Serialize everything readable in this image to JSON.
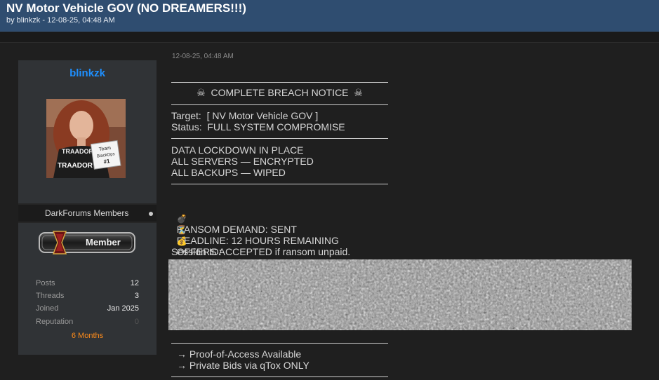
{
  "thread": {
    "title": "NV Motor Vehicle GOV (NO DREAMERS!!!)",
    "meta": "by blinkzk - 12-08-25, 04:48 AM"
  },
  "sidebar": {
    "username": "blinkzk",
    "avatar_label": "profile-photo",
    "sign_text": "Team BlackOps #1",
    "shirt_text": "TRAADOR",
    "group": "DarkForums Members",
    "badge": "Member",
    "stats": [
      {
        "label": "Posts",
        "value": "12"
      },
      {
        "label": "Threads",
        "value": "3"
      },
      {
        "label": "Joined",
        "value": "Jan 2025"
      },
      {
        "label": "Reputation",
        "value": "0"
      }
    ],
    "tenure": "6 Months"
  },
  "post": {
    "date": "12-08-25, 04:48 AM",
    "breach_title": "☠  COMPLETE BREACH NOTICE  ☠",
    "target": "Target:  [ NV Motor Vehicle GOV ]",
    "status": "Status:  FULL SYSTEM COMPROMISE",
    "lockdown": [
      "DATA LOCKDOWN IN PLACE",
      "ALL SERVERS — ENCRYPTED",
      "ALL BACKUPS — WIPED"
    ],
    "ransom": [
      {
        "icon": "bomb-icon",
        "glyph": "💣",
        "text": "RANSOM DEMAND: SENT"
      },
      {
        "icon": "hourglass-icon",
        "glyph": "⏳",
        "text": "DEADLINE: 12 HOURS REMAINING"
      },
      {
        "icon": "money-bag-icon",
        "glyph": "💰",
        "text": "OFFERS ACCEPTED if ransom unpaid."
      }
    ],
    "session_label": "Session ID:",
    "footer": [
      "→ Proof-of-Access Available",
      "→ Private Bids via qTox ONLY"
    ]
  }
}
